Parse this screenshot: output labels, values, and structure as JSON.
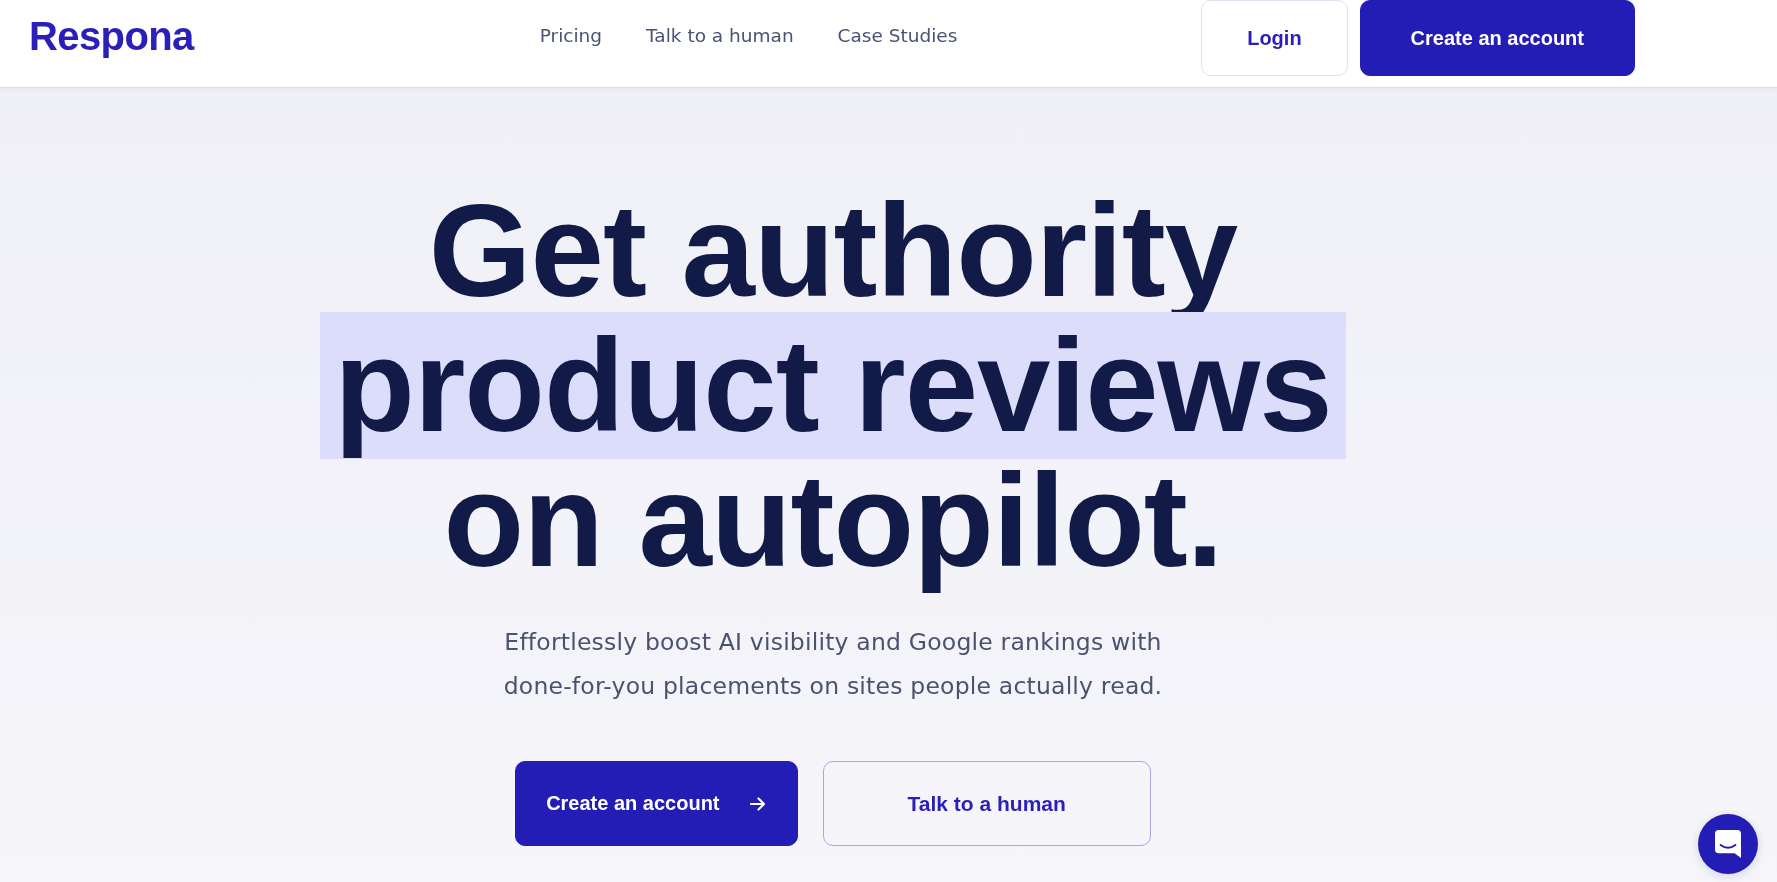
{
  "header": {
    "logo": "Respona",
    "nav": [
      "Pricing",
      "Talk to a human",
      "Case Studies"
    ],
    "buttons": [
      {
        "label": "Login",
        "kind": "light"
      },
      {
        "label": "Create an account",
        "kind": "primary"
      }
    ]
  },
  "hero": {
    "headline": [
      {
        "text": "Get authority",
        "highlighted": false
      },
      {
        "text": "product reviews",
        "highlighted": true
      },
      {
        "text": "on autopilot.",
        "highlighted": false
      }
    ],
    "subtitle": "Effortlessly boost AI visibility and Google rankings with done-for-you placements on sites people actually read.",
    "buttons": [
      {
        "label": "Create an account",
        "kind": "primary",
        "arrow": true
      },
      {
        "label": "Talk to a human",
        "kind": "outline",
        "arrow": false
      }
    ]
  }
}
